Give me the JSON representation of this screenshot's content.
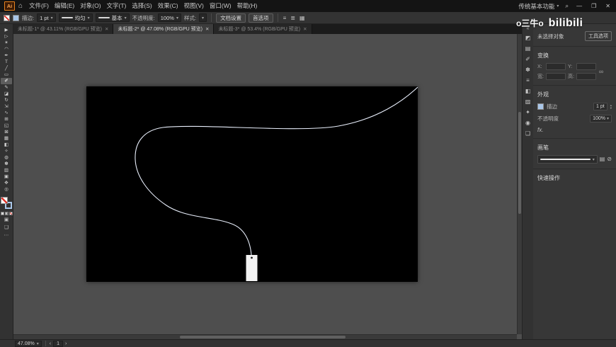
{
  "titlebar": {
    "app_badge": "Ai",
    "menus": [
      {
        "name": "file",
        "label": "文件(F)"
      },
      {
        "name": "edit",
        "label": "编辑(E)"
      },
      {
        "name": "object",
        "label": "对象(O)"
      },
      {
        "name": "type",
        "label": "文字(T)"
      },
      {
        "name": "select",
        "label": "选择(S)"
      },
      {
        "name": "effect",
        "label": "效果(C)"
      },
      {
        "name": "view",
        "label": "视图(V)"
      },
      {
        "name": "window",
        "label": "窗口(W)"
      },
      {
        "name": "help",
        "label": "帮助(H)"
      }
    ],
    "workspace_label": "传统基本功能"
  },
  "icons": {
    "home": "⌂",
    "caret_down": "▾",
    "search": "⌕",
    "minimize": "—",
    "restore": "❐",
    "close": "✕",
    "stepper_up": "▴",
    "stepper_down": "▾",
    "link": "∞",
    "collapse": "«",
    "fx": "fx.",
    "align_1": "≡",
    "align_2": "≣",
    "align_3": "▦",
    "brush_libraries": "▤",
    "remove_brush": "⊘",
    "prev": "‹",
    "next": "›",
    "draw_mode": "▣",
    "screen_mode": "❏",
    "more": "⋯"
  },
  "control_bar": {
    "stroke_label": "描边:",
    "stroke_weight": "1 pt",
    "variable_width_profile": "均匀",
    "brush_definition": "基本",
    "opacity_label": "不透明度:",
    "opacity_value": "100%",
    "style_label": "样式:",
    "document_setup_label": "文档设置",
    "preferences_label": "首选项"
  },
  "tabs": [
    {
      "label": "未标题-1* @ 43.11% (RGB/GPU 预览)",
      "close": "✕",
      "active": false
    },
    {
      "label": "未标题-2* @ 47.08% (RGB/GPU 预览)",
      "close": "✕",
      "active": true
    },
    {
      "label": "未标题-3* @ 53.4% (RGB/GPU 预览)",
      "close": "✕",
      "active": false
    }
  ],
  "toolbar": {
    "tools": [
      {
        "name": "selection",
        "glyph": "▶"
      },
      {
        "name": "direct-selection",
        "glyph": "▷"
      },
      {
        "name": "magic-wand",
        "glyph": "✶"
      },
      {
        "name": "lasso",
        "glyph": "◠"
      },
      {
        "name": "pen",
        "glyph": "✒"
      },
      {
        "name": "type",
        "glyph": "T"
      },
      {
        "name": "line-segment",
        "glyph": "╱"
      },
      {
        "name": "rectangle",
        "glyph": "▭"
      },
      {
        "name": "paintbrush",
        "glyph": "✐",
        "selected": true
      },
      {
        "name": "pencil",
        "glyph": "✎"
      },
      {
        "name": "eraser",
        "glyph": "◪"
      },
      {
        "name": "rotate",
        "glyph": "↻"
      },
      {
        "name": "scale",
        "glyph": "⇲"
      },
      {
        "name": "width",
        "glyph": "∿"
      },
      {
        "name": "free-transform",
        "glyph": "⊞"
      },
      {
        "name": "shape-builder",
        "glyph": "◱"
      },
      {
        "name": "perspective-grid",
        "glyph": "⊠"
      },
      {
        "name": "mesh",
        "glyph": "▦"
      },
      {
        "name": "gradient",
        "glyph": "◧"
      },
      {
        "name": "eyedropper",
        "glyph": "✧"
      },
      {
        "name": "blend",
        "glyph": "◍"
      },
      {
        "name": "symbol-sprayer",
        "glyph": "✽"
      },
      {
        "name": "column-graph",
        "glyph": "▥"
      },
      {
        "name": "artboard",
        "glyph": "▣"
      },
      {
        "name": "hand",
        "glyph": "✥"
      },
      {
        "name": "zoom",
        "glyph": "◎"
      }
    ]
  },
  "canvas": {
    "pasteboard_color": "#4e4e4e",
    "artboard_color": "#000000",
    "path_color": "#e8eefb",
    "rect_color": "#f2f2f2"
  },
  "right_dock": {
    "icons": [
      {
        "name": "color",
        "glyph": "◩"
      },
      {
        "name": "swatches",
        "glyph": "▤"
      },
      {
        "name": "brushes",
        "glyph": "✐"
      },
      {
        "name": "symbols",
        "glyph": "✽"
      },
      {
        "name": "stroke",
        "glyph": "≡"
      },
      {
        "name": "gradient",
        "glyph": "◧"
      },
      {
        "name": "transparency",
        "glyph": "▨"
      },
      {
        "name": "graphic-styles",
        "glyph": "✦"
      },
      {
        "name": "appearance",
        "glyph": "◉"
      },
      {
        "name": "layers",
        "glyph": "❏"
      }
    ]
  },
  "right_panel": {
    "header": "未选择对象",
    "tool_options_label": "工具选项",
    "transform": {
      "title": "变换",
      "x_label": "X:",
      "y_label": "Y:",
      "w_label": "宽:",
      "h_label": "高:"
    },
    "appearance": {
      "title": "外观",
      "stroke_label": "描边",
      "stroke_weight": "1 pt",
      "opacity_label": "不透明度",
      "opacity_value": "100%"
    },
    "brush": {
      "title": "画笔"
    },
    "quick_actions_title": "快速操作"
  },
  "statusbar": {
    "zoom": "47.08%",
    "artboard_number": "1"
  },
  "watermark": {
    "uploader": "o三牛o",
    "site": "bilibili"
  }
}
